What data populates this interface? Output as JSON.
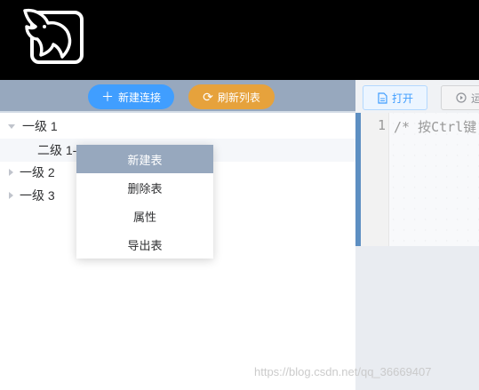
{
  "header": {
    "logo_icon": "dolphin-logo-icon"
  },
  "left_toolbar": {
    "new_connection_label": "新建连接",
    "new_connection_icon": "plus-icon",
    "refresh_label": "刷新列表",
    "refresh_icon": "refresh-icon",
    "colors": {
      "new": "#409eff",
      "refresh": "#e6a23c",
      "bar": "#97a8be"
    }
  },
  "tree": {
    "items": [
      {
        "label": "一级 1",
        "expanded": true
      },
      {
        "label": "二级 1-",
        "child": true,
        "selected": true
      },
      {
        "label": "一级 2",
        "expanded": false
      },
      {
        "label": "一级 3",
        "expanded": false
      }
    ]
  },
  "context_menu": {
    "items": [
      {
        "label": "新建表",
        "active": true
      },
      {
        "label": "删除表"
      },
      {
        "label": "属性"
      },
      {
        "label": "导出表"
      }
    ]
  },
  "right_toolbar": {
    "open_label": "打开",
    "open_icon": "file-icon",
    "run_label": "运",
    "run_icon": "play-circle-icon"
  },
  "editor": {
    "line_number": "1",
    "code": "/* 按Ctrl键"
  },
  "watermark": "https://blog.csdn.net/qq_36669407"
}
